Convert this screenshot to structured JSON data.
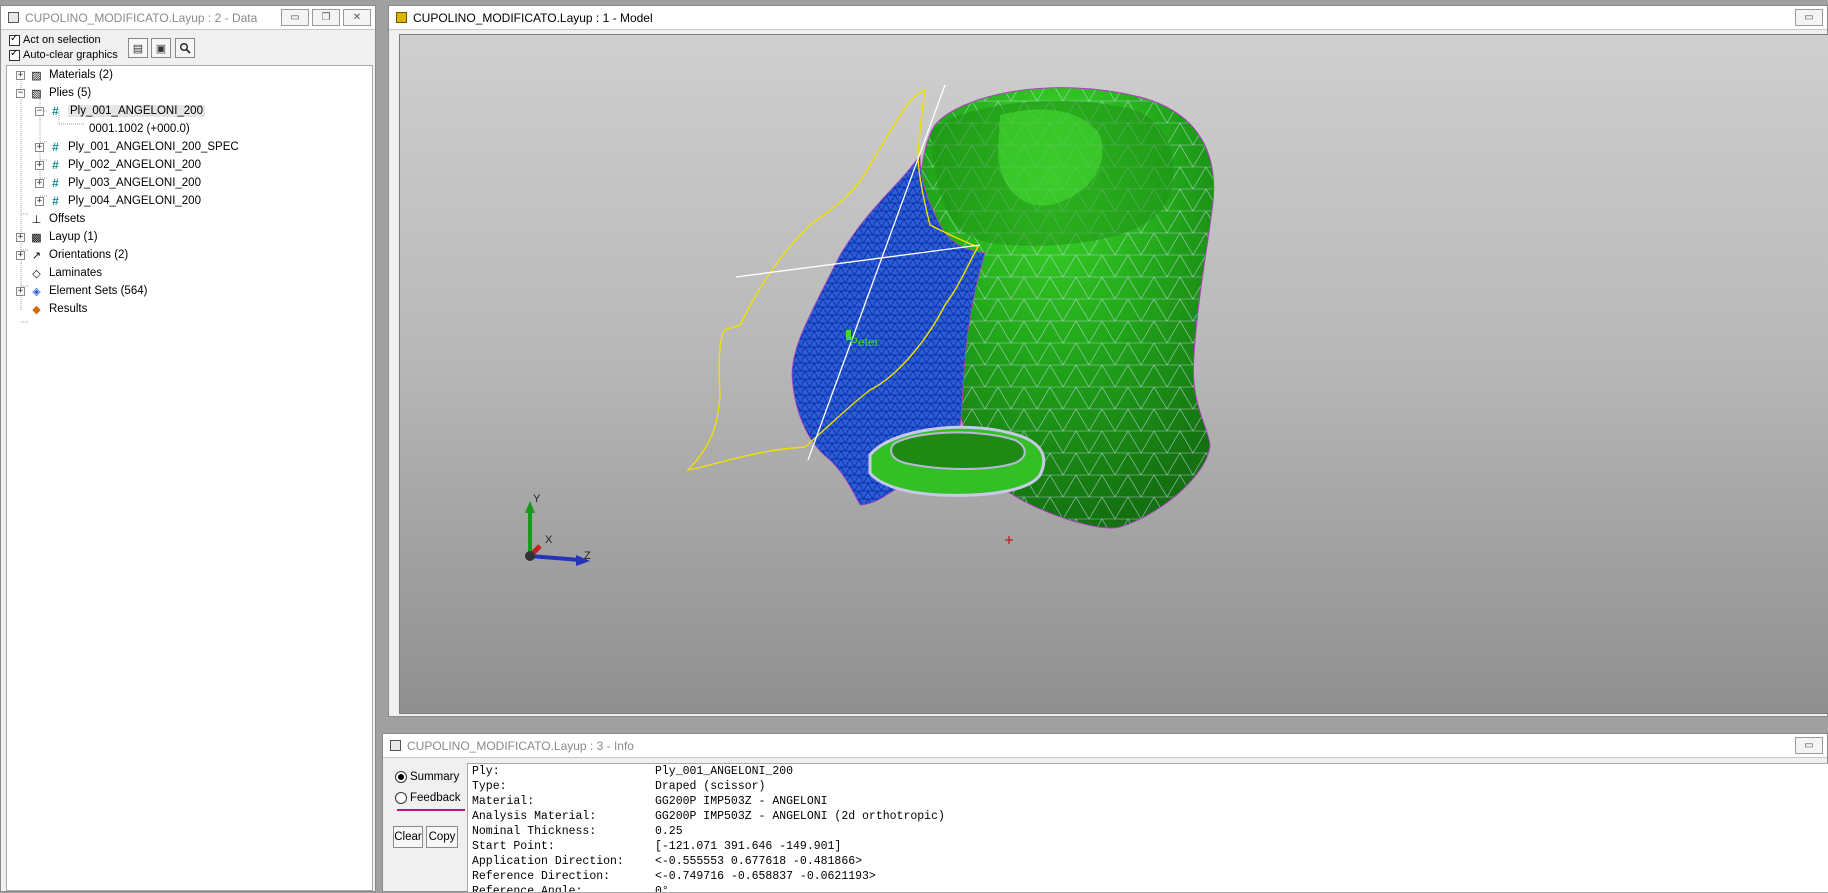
{
  "data_window": {
    "title": "CUPOLINO_MODIFICATO.Layup : 2 - Data",
    "act_on_selection": "Act on selection",
    "auto_clear": "Auto-clear graphics",
    "tree": [
      {
        "label": "Materials (2)",
        "icon": "materials-icon",
        "expander": "+"
      },
      {
        "label": "Plies (5)",
        "icon": "plies-icon",
        "expander": "-"
      },
      {
        "label": "Ply_001_ANGELONI_200",
        "icon": "ply-hash-icon",
        "expander": "-"
      },
      {
        "label": "0001.1002 (+000.0)",
        "icon": "",
        "expander": ""
      },
      {
        "label": "Ply_001_ANGELONI_200_SPEC",
        "icon": "ply-hash-icon",
        "expander": "+"
      },
      {
        "label": "Ply_002_ANGELONI_200",
        "icon": "ply-hash-icon",
        "expander": "+"
      },
      {
        "label": "Ply_003_ANGELONI_200",
        "icon": "ply-hash-icon",
        "expander": "+"
      },
      {
        "label": "Ply_004_ANGELONI_200",
        "icon": "ply-hash-icon",
        "expander": "+"
      },
      {
        "label": "Offsets",
        "icon": "offsets-icon",
        "expander": ""
      },
      {
        "label": "Layup (1)",
        "icon": "layup-icon",
        "expander": "+"
      },
      {
        "label": "Orientations (2)",
        "icon": "orientation-arrow-icon",
        "expander": "+"
      },
      {
        "label": "Laminates",
        "icon": "laminates-icon",
        "expander": ""
      },
      {
        "label": "Element Sets (564)",
        "icon": "element-sets-icon",
        "expander": "+"
      },
      {
        "label": "Results",
        "icon": "results-icon",
        "expander": ""
      }
    ]
  },
  "model_window": {
    "title": "CUPOLINO_MODIFICATO.Layup : 1 - Model",
    "viewport_label": "Peter",
    "axes": {
      "x": "X",
      "y": "Y",
      "z": "Z"
    },
    "colors": {
      "mesh_green": "#22a81a",
      "mesh_blue": "#2a5fd0",
      "boundary_yellow": "#f0e000"
    }
  },
  "info_window": {
    "title": "CUPOLINO_MODIFICATO.Layup : 3 - Info",
    "summary_label": "Summary",
    "feedback_label": "Feedback",
    "clear_label": "Clear",
    "copy_label": "Copy",
    "rows": [
      {
        "key": "Ply:",
        "value": "Ply_001_ANGELONI_200"
      },
      {
        "key": "Type:",
        "value": "Draped (scissor)"
      },
      {
        "key": "Material:",
        "value": "GG200P IMP503Z - ANGELONI"
      },
      {
        "key": "Analysis Material:",
        "value": "GG200P IMP503Z - ANGELONI (2d orthotropic)"
      },
      {
        "key": "Nominal Thickness:",
        "value": "0.25"
      },
      {
        "key": "Start Point:",
        "value": "[-121.071 391.646 -149.901]"
      },
      {
        "key": "Application Direction:",
        "value": "<-0.555553 0.677618 -0.481866>"
      },
      {
        "key": "Reference Direction:",
        "value": "<-0.749716 -0.658837 -0.0621193>"
      },
      {
        "key": "Reference Angle:",
        "value": "0°"
      }
    ]
  }
}
